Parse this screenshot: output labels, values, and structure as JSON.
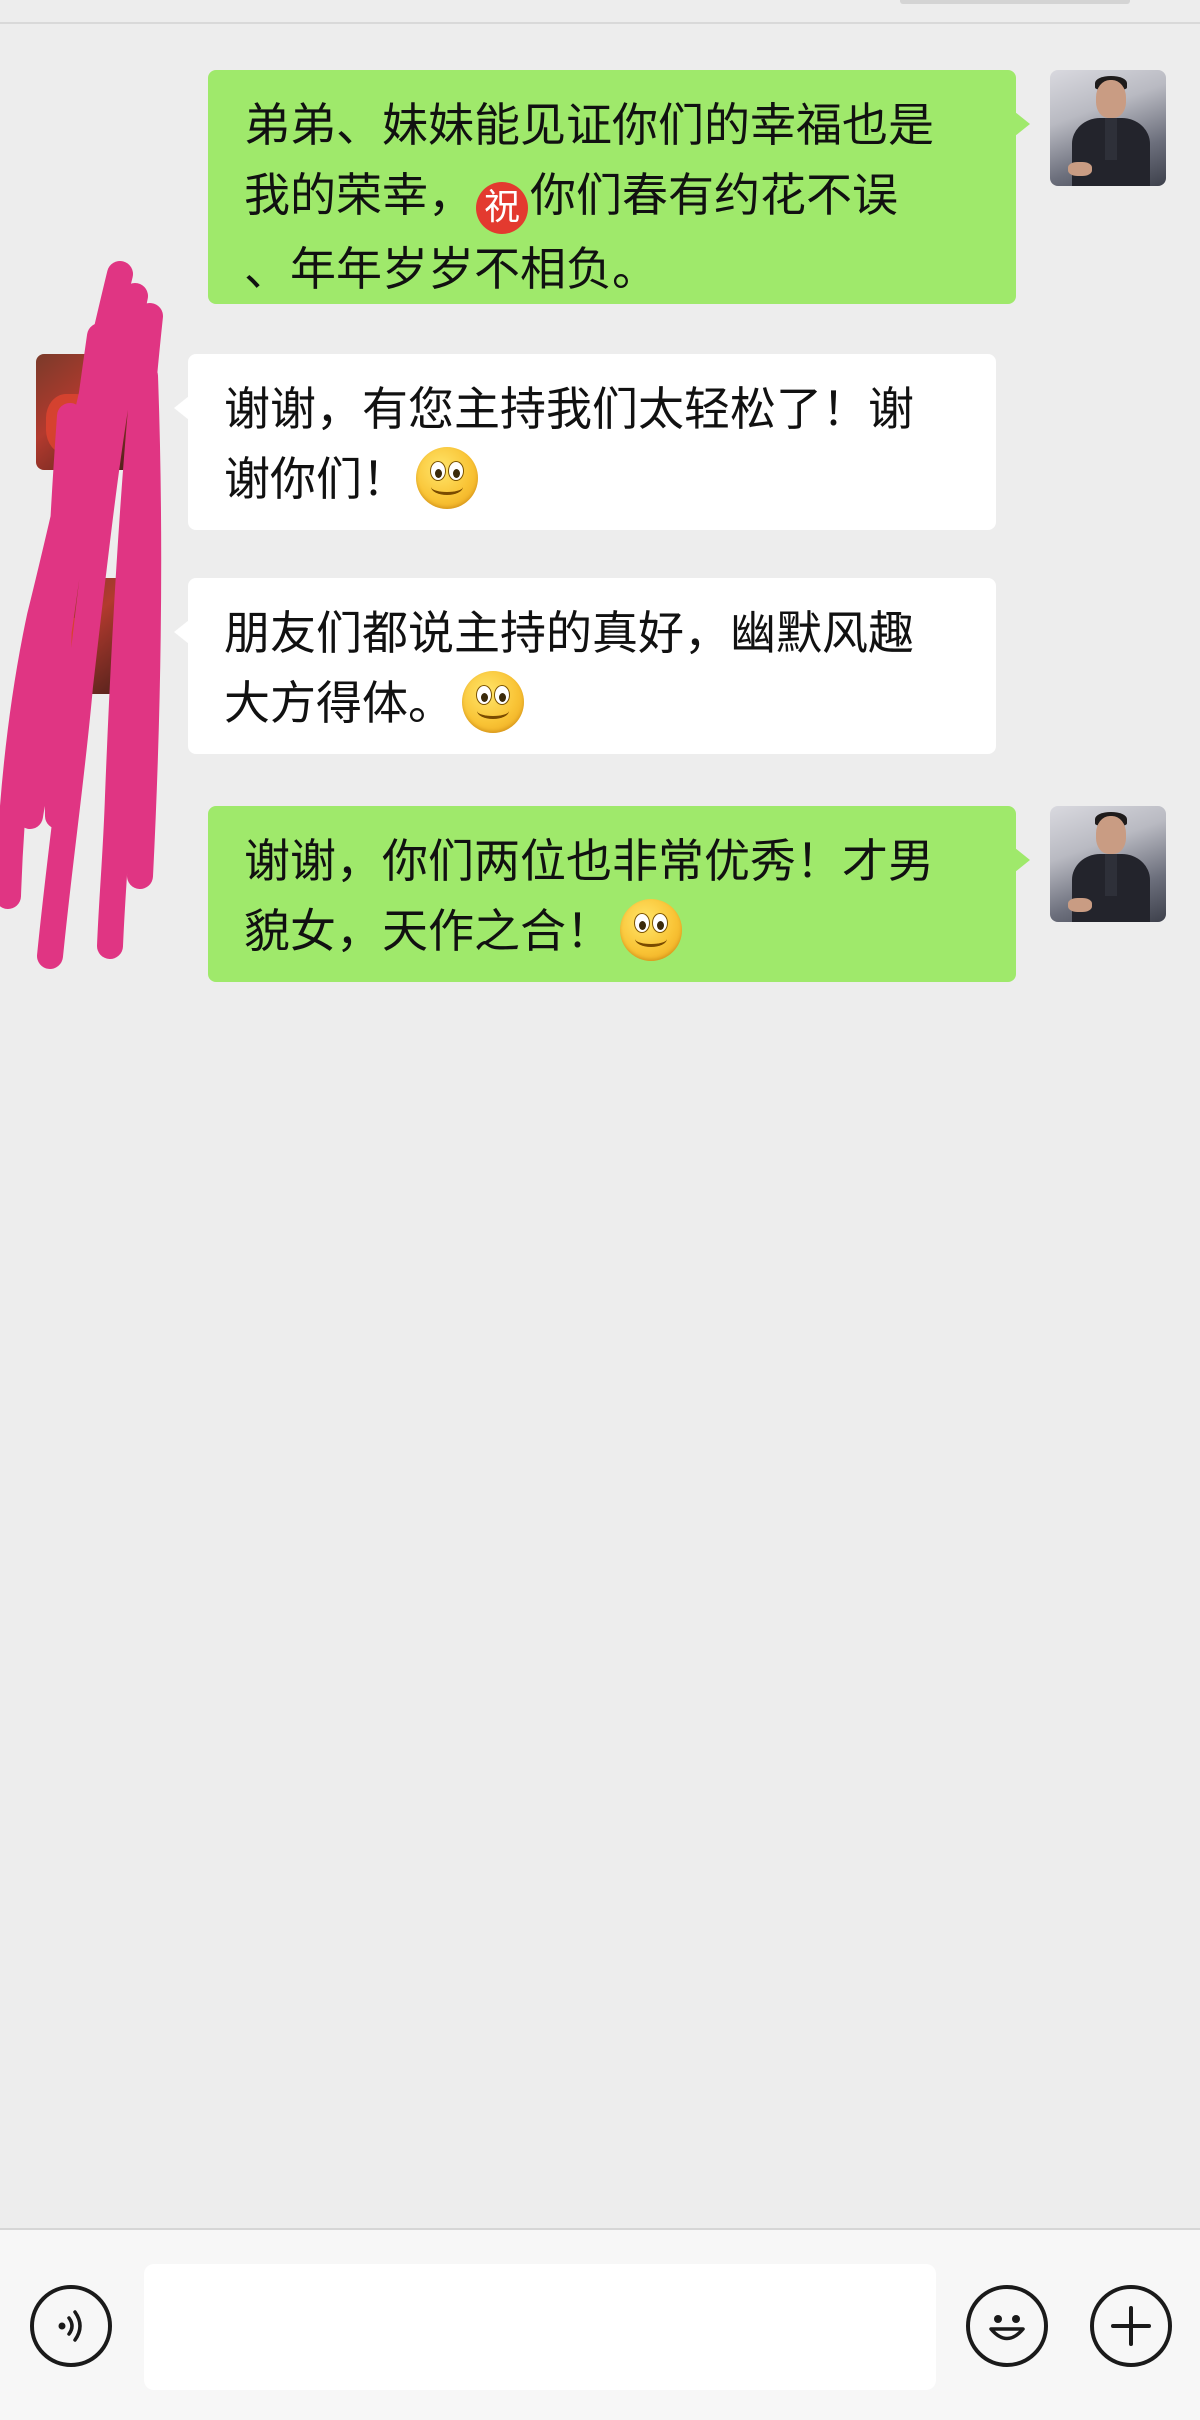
{
  "messages": [
    {
      "sender": "me",
      "lines": [
        "弟弟、妹妹能见证你们的幸福也是",
        "我的荣幸，",
        "你们春有约花不误",
        "、年年岁岁不相负。"
      ],
      "inline_badge": "祝"
    },
    {
      "sender": "other",
      "lines": [
        "谢谢，有您主持我们太轻松了！谢",
        "谢你们！"
      ],
      "emoji": "smile-emoji"
    },
    {
      "sender": "other",
      "lines": [
        "朋友们都说主持的真好，幽默风趣",
        "大方得体。"
      ],
      "emoji": "smile-emoji"
    },
    {
      "sender": "me",
      "lines": [
        "谢谢，你们两位也非常优秀！才男",
        "貌女，天作之合！"
      ],
      "emoji": "smile-emoji"
    }
  ],
  "input_bar": {
    "placeholder": "",
    "icons": [
      "voice-icon",
      "emoji-icon",
      "plus-icon"
    ]
  },
  "colors": {
    "background": "#ededed",
    "my_bubble": "#9fe96b",
    "their_bubble": "#ffffff",
    "redaction": "#e03583"
  }
}
